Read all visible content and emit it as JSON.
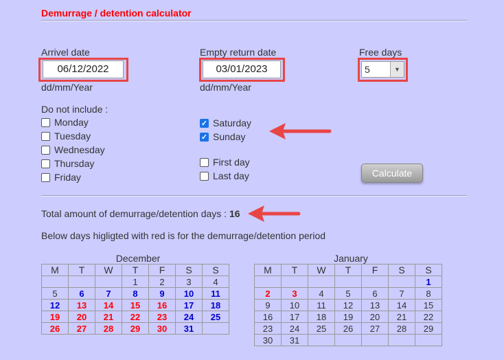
{
  "title": "Demurrage / detention calculator",
  "arrive": {
    "label": "Arrivel date",
    "value": "06/12/2022",
    "format": "dd/mm/Year"
  },
  "empty_return": {
    "label": "Empty return date",
    "value": "03/01/2023",
    "format": "dd/mm/Year"
  },
  "free_days": {
    "label": "Free days",
    "value": "5"
  },
  "exclude": {
    "label": "Do not include :",
    "days": [
      {
        "label": "Monday",
        "checked": false
      },
      {
        "label": "Tuesday",
        "checked": false
      },
      {
        "label": "Wednesday",
        "checked": false
      },
      {
        "label": "Thursday",
        "checked": false
      },
      {
        "label": "Friday",
        "checked": false
      }
    ],
    "weekend": [
      {
        "label": "Saturday",
        "checked": true
      },
      {
        "label": "Sunday",
        "checked": true
      }
    ],
    "other": [
      {
        "label": "First day",
        "checked": false
      },
      {
        "label": "Last day",
        "checked": false
      }
    ]
  },
  "calculate_label": "Calculate",
  "result": {
    "label": "Total amount of demurrage/detention days :",
    "value": "16"
  },
  "note": "Below days higligted with red is for the demurrage/detention period",
  "weekdays": [
    "M",
    "T",
    "W",
    "T",
    "F",
    "S",
    "S"
  ],
  "colors": {
    "red": "#ff0000",
    "blue": "#0000cc",
    "frame": "#e84545",
    "background": "#ccccff"
  },
  "calendars": [
    {
      "month": "December",
      "rows": [
        [
          {
            "d": ""
          },
          {
            "d": ""
          },
          {
            "d": ""
          },
          {
            "d": "1"
          },
          {
            "d": "2"
          },
          {
            "d": "3"
          },
          {
            "d": "4"
          }
        ],
        [
          {
            "d": "5"
          },
          {
            "d": "6",
            "c": "b"
          },
          {
            "d": "7",
            "c": "b"
          },
          {
            "d": "8",
            "c": "b"
          },
          {
            "d": "9",
            "c": "b"
          },
          {
            "d": "10",
            "c": "b"
          },
          {
            "d": "11",
            "c": "b"
          }
        ],
        [
          {
            "d": "12",
            "c": "b"
          },
          {
            "d": "13",
            "c": "r"
          },
          {
            "d": "14",
            "c": "r"
          },
          {
            "d": "15",
            "c": "r"
          },
          {
            "d": "16",
            "c": "r"
          },
          {
            "d": "17",
            "c": "b"
          },
          {
            "d": "18",
            "c": "b"
          }
        ],
        [
          {
            "d": "19",
            "c": "r"
          },
          {
            "d": "20",
            "c": "r"
          },
          {
            "d": "21",
            "c": "r"
          },
          {
            "d": "22",
            "c": "r"
          },
          {
            "d": "23",
            "c": "r"
          },
          {
            "d": "24",
            "c": "b"
          },
          {
            "d": "25",
            "c": "b"
          }
        ],
        [
          {
            "d": "26",
            "c": "r"
          },
          {
            "d": "27",
            "c": "r"
          },
          {
            "d": "28",
            "c": "r"
          },
          {
            "d": "29",
            "c": "r"
          },
          {
            "d": "30",
            "c": "r"
          },
          {
            "d": "31",
            "c": "b"
          },
          {
            "d": ""
          }
        ]
      ]
    },
    {
      "month": "January",
      "rows": [
        [
          {
            "d": ""
          },
          {
            "d": ""
          },
          {
            "d": ""
          },
          {
            "d": ""
          },
          {
            "d": ""
          },
          {
            "d": ""
          },
          {
            "d": "1",
            "c": "b"
          }
        ],
        [
          {
            "d": "2",
            "c": "r"
          },
          {
            "d": "3",
            "c": "r"
          },
          {
            "d": "4"
          },
          {
            "d": "5"
          },
          {
            "d": "6"
          },
          {
            "d": "7"
          },
          {
            "d": "8"
          }
        ],
        [
          {
            "d": "9"
          },
          {
            "d": "10"
          },
          {
            "d": "11"
          },
          {
            "d": "12"
          },
          {
            "d": "13"
          },
          {
            "d": "14"
          },
          {
            "d": "15"
          }
        ],
        [
          {
            "d": "16"
          },
          {
            "d": "17"
          },
          {
            "d": "18"
          },
          {
            "d": "19"
          },
          {
            "d": "20"
          },
          {
            "d": "21"
          },
          {
            "d": "22"
          }
        ],
        [
          {
            "d": "23"
          },
          {
            "d": "24"
          },
          {
            "d": "25"
          },
          {
            "d": "26"
          },
          {
            "d": "27"
          },
          {
            "d": "28"
          },
          {
            "d": "29"
          }
        ],
        [
          {
            "d": "30"
          },
          {
            "d": "31"
          },
          {
            "d": ""
          },
          {
            "d": ""
          },
          {
            "d": ""
          },
          {
            "d": ""
          },
          {
            "d": ""
          }
        ]
      ]
    }
  ]
}
